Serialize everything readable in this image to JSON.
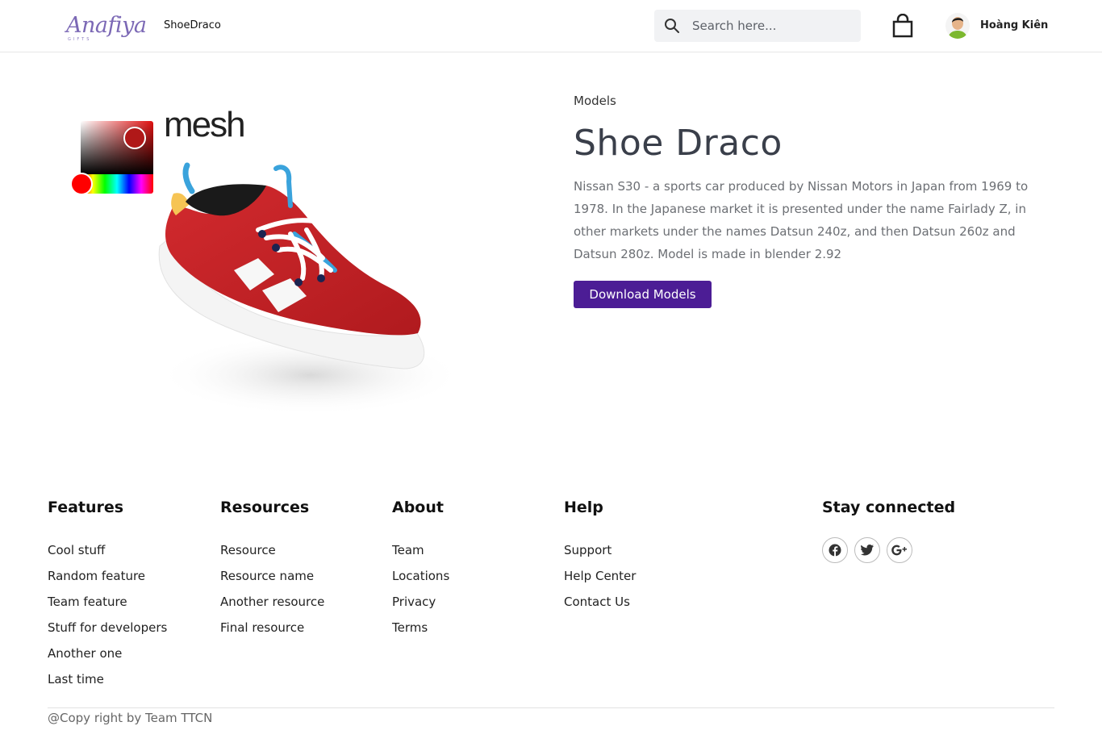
{
  "header": {
    "logo_text": "Anafiya",
    "logo_sub": "GIFTS",
    "brand_link": "ShoeDraco",
    "search_placeholder": "Search here...",
    "user_name": "Hoàng Kiên"
  },
  "viewer": {
    "mesh_label": "mesh",
    "picker_color": "#b01818"
  },
  "product": {
    "category": "Models",
    "title": "Shoe Draco",
    "description": "Nissan S30 - a sports car produced by Nissan Motors in Japan from 1969 to 1978. In the Japanese market it is presented under the name Fairlady Z, in other markets under the names Datsun 240z, and then Datsun 260z and Datsun 280z. Model is made in blender 2.92",
    "download_label": "Download Models",
    "button_color": "#4c1d95"
  },
  "footer": {
    "features": {
      "heading": "Features",
      "items": [
        "Cool stuff",
        "Random feature",
        "Team feature",
        "Stuff for developers",
        "Another one",
        "Last time"
      ]
    },
    "resources": {
      "heading": "Resources",
      "items": [
        "Resource",
        "Resource name",
        "Another resource",
        "Final resource"
      ]
    },
    "about": {
      "heading": "About",
      "items": [
        "Team",
        "Locations",
        "Privacy",
        "Terms"
      ]
    },
    "help": {
      "heading": "Help",
      "items": [
        "Support",
        "Help Center",
        "Contact Us"
      ]
    },
    "social": {
      "heading": "Stay connected",
      "icons": [
        "facebook-icon",
        "twitter-icon",
        "google-plus-icon"
      ]
    },
    "copyright": "@Copy right by Team TTCN"
  }
}
